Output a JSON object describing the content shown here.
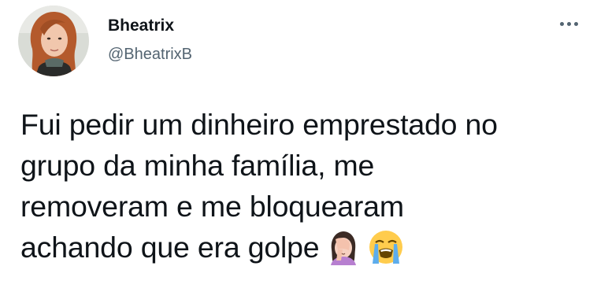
{
  "tweet": {
    "author": {
      "display_name": "Bheatrix",
      "handle": "@BheatrixB",
      "avatar_icon": "profile-photo"
    },
    "more_options_icon": "ellipsis-icon",
    "text_lines": [
      "Fui pedir um dinheiro emprestado no",
      "grupo da minha família, me",
      "removeram e me bloquearam",
      "achando que era golpe"
    ],
    "emojis": [
      "woman-facepalming-emoji",
      "loudly-crying-face-emoji"
    ]
  }
}
